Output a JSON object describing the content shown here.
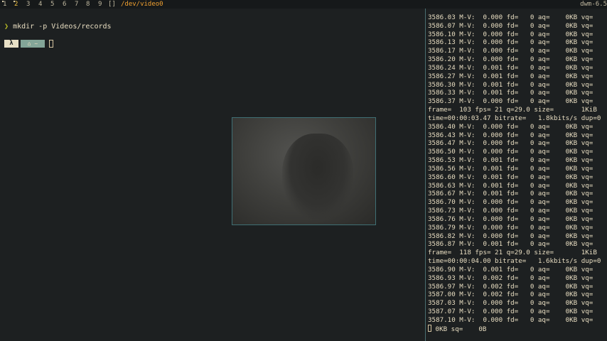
{
  "bar": {
    "tags": [
      {
        "label": "1",
        "active": false
      },
      {
        "label": "2",
        "active": true
      },
      {
        "label": "3",
        "active": false
      },
      {
        "label": "4",
        "active": false
      },
      {
        "label": "5",
        "active": false
      },
      {
        "label": "6",
        "active": false
      },
      {
        "label": "7",
        "active": false
      },
      {
        "label": "8",
        "active": false
      },
      {
        "label": "9",
        "active": false
      }
    ],
    "layout_symbol": "[]",
    "window_title": "/dev/video0",
    "status": "dwm-6.5"
  },
  "left_terminal": {
    "prompt_arrow": "❯",
    "command": "mkdir -p Videos/records",
    "prompt_segment_1": "λ",
    "prompt_segment_2": "⌂ ~"
  },
  "right_terminal": {
    "lines": [
      "3586.03 M-V:  0.000 fd=   0 aq=    0KB vq=",
      "3586.07 M-V:  0.000 fd=   0 aq=    0KB vq=",
      "3586.10 M-V:  0.000 fd=   0 aq=    0KB vq=",
      "3586.13 M-V:  0.000 fd=   0 aq=    0KB vq=",
      "3586.17 M-V:  0.000 fd=   0 aq=    0KB vq=",
      "3586.20 M-V:  0.000 fd=   0 aq=    0KB vq=",
      "3586.24 M-V:  0.001 fd=   0 aq=    0KB vq=",
      "3586.27 M-V:  0.001 fd=   0 aq=    0KB vq=",
      "3586.30 M-V:  0.001 fd=   0 aq=    0KB vq=",
      "3586.33 M-V:  0.001 fd=   0 aq=    0KB vq=",
      "3586.37 M-V:  0.000 fd=   0 aq=    0KB vq=",
      "frame=  103 fps= 21 q=29.0 size=       1KiB",
      "time=00:00:03.47 bitrate=   1.8kbits/s dup=0",
      "3586.40 M-V:  0.000 fd=   0 aq=    0KB vq=",
      "3586.43 M-V:  0.000 fd=   0 aq=    0KB vq=",
      "3586.47 M-V:  0.000 fd=   0 aq=    0KB vq=",
      "3586.50 M-V:  0.000 fd=   0 aq=    0KB vq=",
      "3586.53 M-V:  0.001 fd=   0 aq=    0KB vq=",
      "3586.56 M-V:  0.001 fd=   0 aq=    0KB vq=",
      "3586.60 M-V:  0.001 fd=   0 aq=    0KB vq=",
      "3586.63 M-V:  0.001 fd=   0 aq=    0KB vq=",
      "3586.67 M-V:  0.001 fd=   0 aq=    0KB vq=",
      "3586.70 M-V:  0.000 fd=   0 aq=    0KB vq=",
      "3586.73 M-V:  0.000 fd=   0 aq=    0KB vq=",
      "3586.76 M-V:  0.000 fd=   0 aq=    0KB vq=",
      "3586.79 M-V:  0.000 fd=   0 aq=    0KB vq=",
      "3586.82 M-V:  0.000 fd=   0 aq=    0KB vq=",
      "3586.87 M-V:  0.001 fd=   0 aq=    0KB vq=",
      "frame=  118 fps= 21 q=29.0 size=       1KiB",
      "time=00:00:04.00 bitrate=   1.6kbits/s dup=0",
      "3586.90 M-V:  0.001 fd=   0 aq=    0KB vq=",
      "3586.93 M-V:  0.002 fd=   0 aq=    0KB vq=",
      "3586.97 M-V:  0.002 fd=   0 aq=    0KB vq=",
      "3587.00 M-V:  0.002 fd=   0 aq=    0KB vq=",
      "3587.03 M-V:  0.000 fd=   0 aq=    0KB vq=",
      "3587.07 M-V:  0.000 fd=   0 aq=    0KB vq=",
      "3587.10 M-V:  0.000 fd=   0 aq=    0KB vq="
    ],
    "last_line": " 0KB sq=    0B"
  },
  "colors": {
    "bar_bg": "#16191a",
    "active_tag": "#f0c040",
    "window_title": "#f0a030",
    "terminal_bg": "#1d2021",
    "terminal_fg": "#e7dcc0",
    "prompt_green": "#b8bb26",
    "home_segment": "#83a598"
  }
}
